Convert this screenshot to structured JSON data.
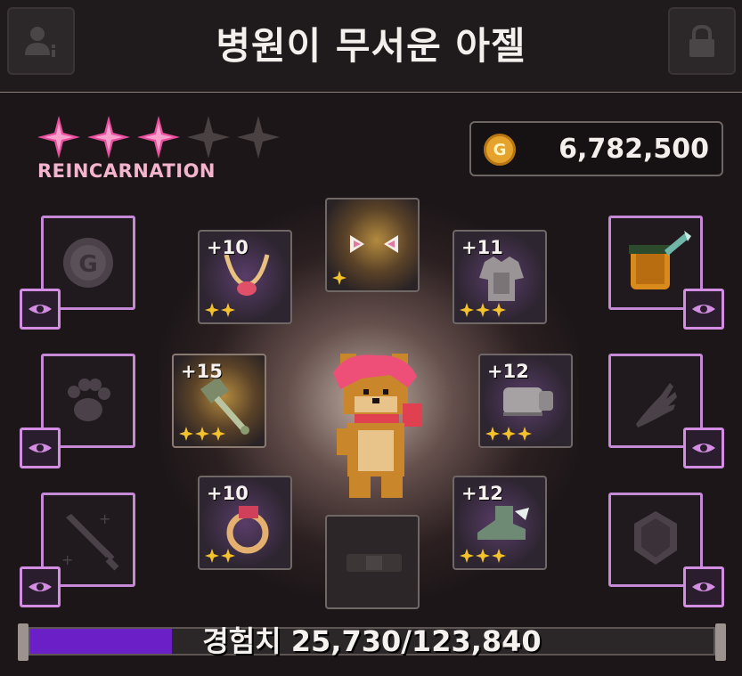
{
  "header": {
    "title": "병원이 무서운 아젤",
    "left_button_icon": "profile-info-icon",
    "right_button_icon": "lock-icon"
  },
  "stars": {
    "filled": 3,
    "total": 5,
    "label": "REINCARNATION",
    "filled_color": "#e84f9f",
    "empty_color": "#4a4142"
  },
  "gold": {
    "value": "6,782,500",
    "coin_symbol": "G"
  },
  "equipment": [
    {
      "id": "necklace",
      "enhance": "+10",
      "rank": 2,
      "icon": "necklace-icon"
    },
    {
      "id": "head",
      "enhance": "",
      "rank": 1,
      "icon": "cat-ears-icon"
    },
    {
      "id": "armor",
      "enhance": "+11",
      "rank": 3,
      "icon": "armor-icon"
    },
    {
      "id": "weapon",
      "enhance": "+15",
      "rank": 3,
      "icon": "hammer-icon"
    },
    {
      "id": "gloves",
      "enhance": "+12",
      "rank": 3,
      "icon": "gloves-icon"
    },
    {
      "id": "ring",
      "enhance": "+10",
      "rank": 2,
      "icon": "ring-icon"
    },
    {
      "id": "belt",
      "enhance": "",
      "rank": 0,
      "icon": "belt-icon"
    },
    {
      "id": "boots",
      "enhance": "+12",
      "rank": 3,
      "icon": "boots-icon"
    }
  ],
  "side_slots": {
    "left": [
      "coin-g-icon",
      "paw-icon",
      "sword-icon"
    ],
    "right": [
      "backpack-icon",
      "wing-icon",
      "gem-icon"
    ]
  },
  "experience": {
    "label": "경험치 25,730/123,840",
    "current": 25730,
    "max": 123840,
    "fill_color": "#6a1fc7"
  }
}
